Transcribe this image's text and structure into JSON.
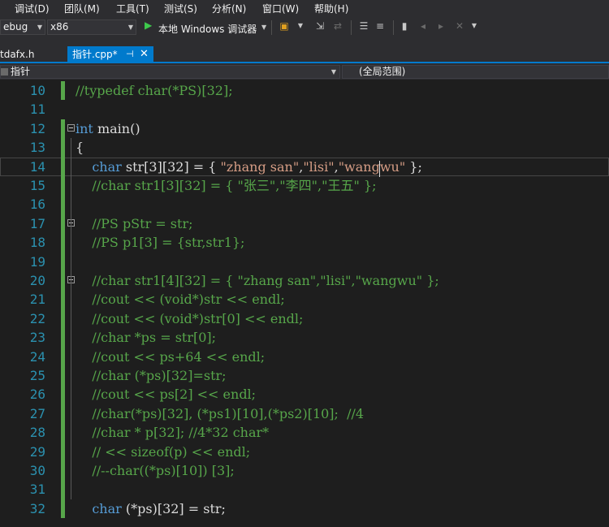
{
  "menu": [
    "调试(D)",
    "团队(M)",
    "工具(T)",
    "测试(S)",
    "分析(N)",
    "窗口(W)",
    "帮助(H)"
  ],
  "toolbar": {
    "config": "ebug",
    "platform": "x86",
    "run_label": "本地 Windows 调试器"
  },
  "tabs": {
    "inactive": "tdafx.h",
    "active": "指针.cpp*",
    "pin_glyph": "⊣",
    "close_glyph": "✕"
  },
  "nav": {
    "scope": "指针",
    "range": "(全局范围)"
  },
  "editor": {
    "lines": [
      {
        "n": "10",
        "tokens": [
          {
            "t": "//typedef char(*PS)[32];",
            "c": "cm"
          }
        ]
      },
      {
        "n": "11",
        "tokens": []
      },
      {
        "n": "12",
        "tokens": [
          {
            "t": "int",
            "c": "kw"
          },
          {
            "t": " main()",
            "c": ""
          }
        ]
      },
      {
        "n": "13",
        "tokens": [
          {
            "t": "{",
            "c": ""
          }
        ]
      },
      {
        "n": "14",
        "tokens": [
          {
            "t": "    ",
            "c": ""
          },
          {
            "t": "char",
            "c": "kw"
          },
          {
            "t": " str[3][32] = { ",
            "c": ""
          },
          {
            "t": "\"zhang san\"",
            "c": "str"
          },
          {
            "t": ",",
            "c": ""
          },
          {
            "t": "\"lisi\"",
            "c": "str"
          },
          {
            "t": ",",
            "c": ""
          },
          {
            "t": "\"wangwu\"",
            "c": "str"
          },
          {
            "t": " };",
            "c": ""
          }
        ]
      },
      {
        "n": "15",
        "tokens": [
          {
            "t": "    //char str1[3][32] = { \"张三\",\"李四\",\"王五\" };",
            "c": "cm"
          }
        ]
      },
      {
        "n": "16",
        "tokens": []
      },
      {
        "n": "17",
        "tokens": [
          {
            "t": "    //PS pStr = str;",
            "c": "cm"
          }
        ]
      },
      {
        "n": "18",
        "tokens": [
          {
            "t": "    //PS p1[3] = {str,str1};",
            "c": "cm"
          }
        ]
      },
      {
        "n": "19",
        "tokens": []
      },
      {
        "n": "20",
        "tokens": [
          {
            "t": "    //char str1[4][32] = { \"zhang san\",\"lisi\",\"wangwu\" };",
            "c": "cm"
          }
        ]
      },
      {
        "n": "21",
        "tokens": [
          {
            "t": "    //cout << (void*)str << endl;",
            "c": "cm"
          }
        ]
      },
      {
        "n": "22",
        "tokens": [
          {
            "t": "    //cout << (void*)str[0] << endl;",
            "c": "cm"
          }
        ]
      },
      {
        "n": "23",
        "tokens": [
          {
            "t": "    //char *ps = str[0];",
            "c": "cm"
          }
        ]
      },
      {
        "n": "24",
        "tokens": [
          {
            "t": "    //cout << ps+64 << endl;",
            "c": "cm"
          }
        ]
      },
      {
        "n": "25",
        "tokens": [
          {
            "t": "    //char (*ps)[32]=str;",
            "c": "cm"
          }
        ]
      },
      {
        "n": "26",
        "tokens": [
          {
            "t": "    //cout << ps[2] << endl;",
            "c": "cm"
          }
        ]
      },
      {
        "n": "27",
        "tokens": [
          {
            "t": "    //char(*ps)[32], (*ps1)[10],(*ps2)[10];  //4",
            "c": "cm"
          }
        ]
      },
      {
        "n": "28",
        "tokens": [
          {
            "t": "    //char * p[32]; //4*32 char*",
            "c": "cm"
          }
        ]
      },
      {
        "n": "29",
        "tokens": [
          {
            "t": "    // << sizeof(p) << endl;",
            "c": "cm"
          }
        ]
      },
      {
        "n": "30",
        "tokens": [
          {
            "t": "    //--char((*ps)[10]) [3];",
            "c": "cm"
          }
        ]
      },
      {
        "n": "31",
        "tokens": []
      },
      {
        "n": "32",
        "tokens": [
          {
            "t": "    ",
            "c": ""
          },
          {
            "t": "char",
            "c": "kw"
          },
          {
            "t": " (*ps)[32] = str;",
            "c": ""
          }
        ]
      }
    ]
  },
  "colors": {
    "keyword": "#569cd6",
    "string": "#d69d85",
    "comment": "#57a64a",
    "line_number": "#2b91af",
    "accent": "#007acc"
  }
}
